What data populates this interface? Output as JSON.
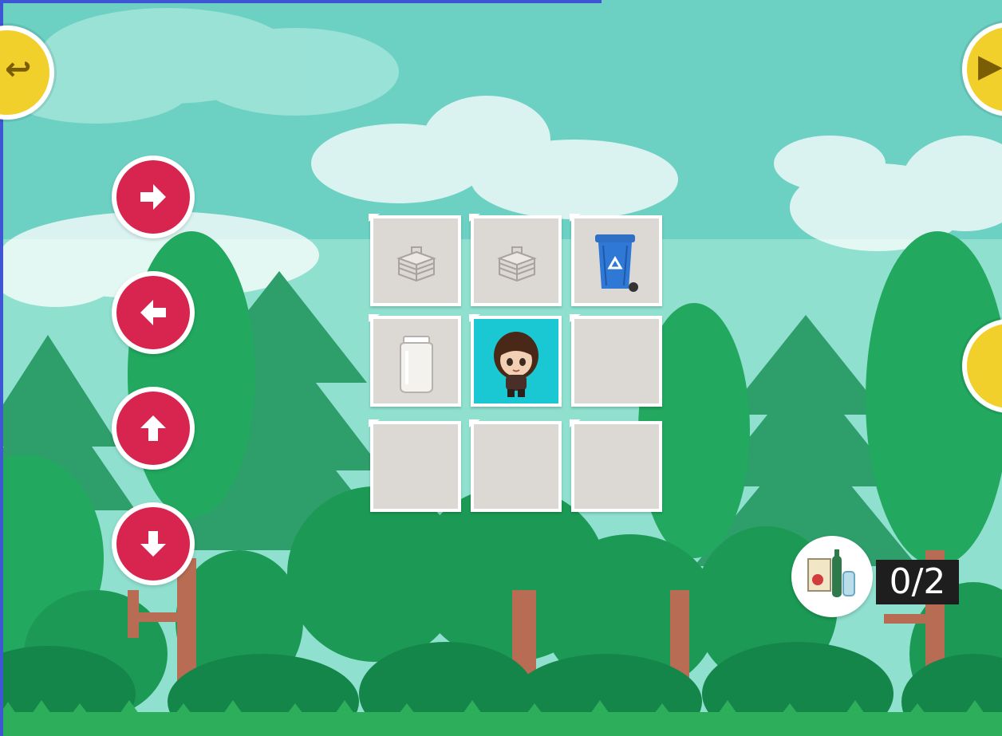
{
  "game": {
    "title": "",
    "controls": [
      {
        "id": "right",
        "direction": "right",
        "icon": "arrow-right-icon"
      },
      {
        "id": "left",
        "direction": "left",
        "icon": "arrow-left-icon"
      },
      {
        "id": "up",
        "direction": "up",
        "icon": "arrow-up-icon"
      },
      {
        "id": "down",
        "direction": "down",
        "icon": "arrow-down-icon"
      }
    ],
    "top_left_coin": {
      "icon": "back-coin-icon"
    },
    "top_right_coin": {
      "icon": "coin-icon"
    },
    "right_coin": {
      "icon": "coin-icon"
    },
    "grid": {
      "rows": 3,
      "cols": 3,
      "cells": [
        {
          "row": 0,
          "col": 0,
          "item": "paper-stack-icon"
        },
        {
          "row": 0,
          "col": 1,
          "item": "paper-stack-icon"
        },
        {
          "row": 0,
          "col": 2,
          "item": "recycle-bin-icon"
        },
        {
          "row": 1,
          "col": 0,
          "item": "glass-jar-icon"
        },
        {
          "row": 1,
          "col": 1,
          "item": "player-character-icon",
          "active": true
        },
        {
          "row": 1,
          "col": 2,
          "item": null
        },
        {
          "row": 2,
          "col": 0,
          "item": null
        },
        {
          "row": 2,
          "col": 1,
          "item": null
        },
        {
          "row": 2,
          "col": 2,
          "item": null
        }
      ]
    },
    "counter": {
      "icon": "recyclables-icon",
      "value": "0/2"
    },
    "colors": {
      "sky": "#6cd0c3",
      "button": "#d8254f",
      "coin": "#f2d02b",
      "active_tile": "#19c8d2"
    }
  }
}
